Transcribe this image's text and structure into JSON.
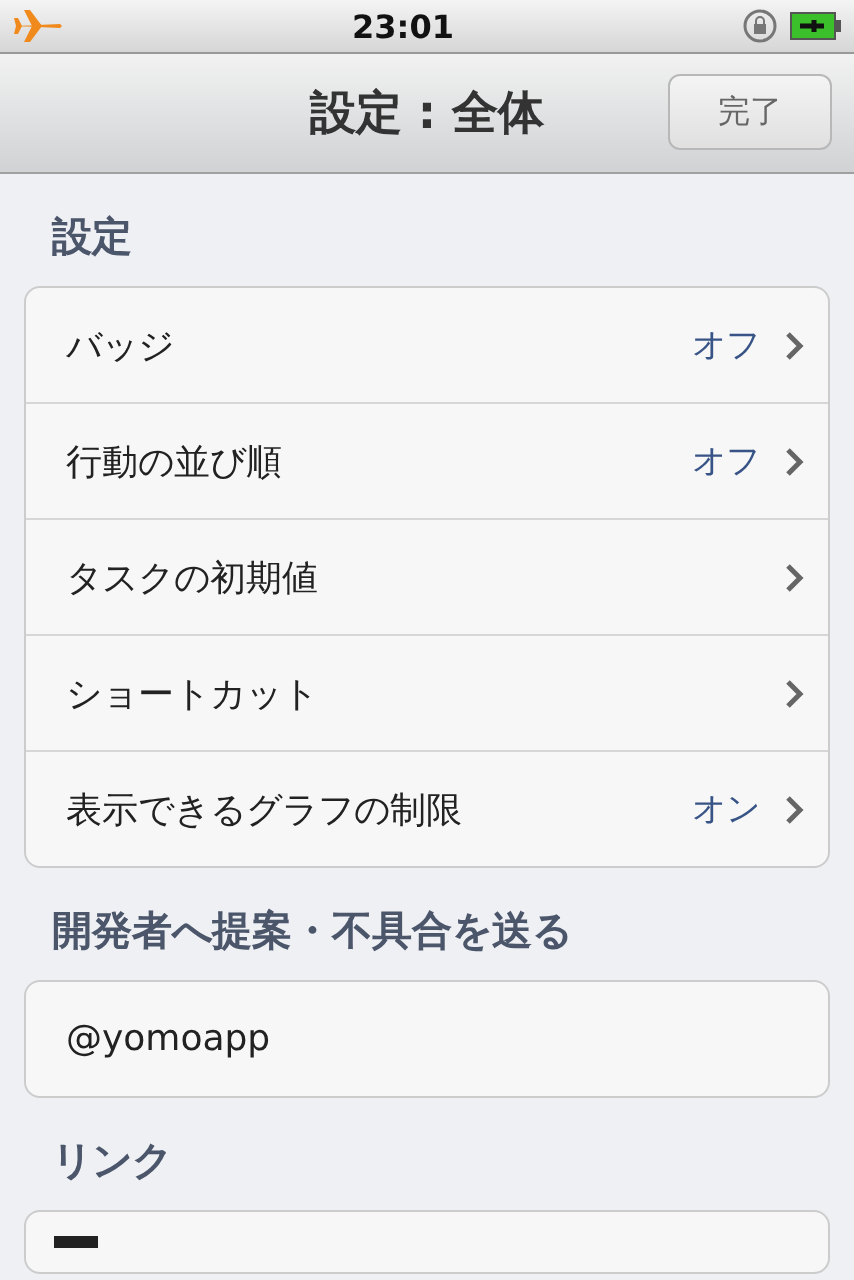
{
  "status_bar": {
    "time": "23:01"
  },
  "nav_bar": {
    "title": "設定 : 全体",
    "done_button": "完了"
  },
  "sections": [
    {
      "header": "設定",
      "rows": [
        {
          "label": "バッジ",
          "value": "オフ"
        },
        {
          "label": "行動の並び順",
          "value": "オフ"
        },
        {
          "label": "タスクの初期値"
        },
        {
          "label": "ショートカット"
        },
        {
          "label": "表示できるグラフの制限",
          "value": "オン"
        }
      ]
    },
    {
      "header": "開発者へ提案・不具合を送る",
      "rows": [
        {
          "label": "@yomoapp",
          "plain": true
        }
      ]
    },
    {
      "header": "リンク",
      "partial": true
    }
  ]
}
